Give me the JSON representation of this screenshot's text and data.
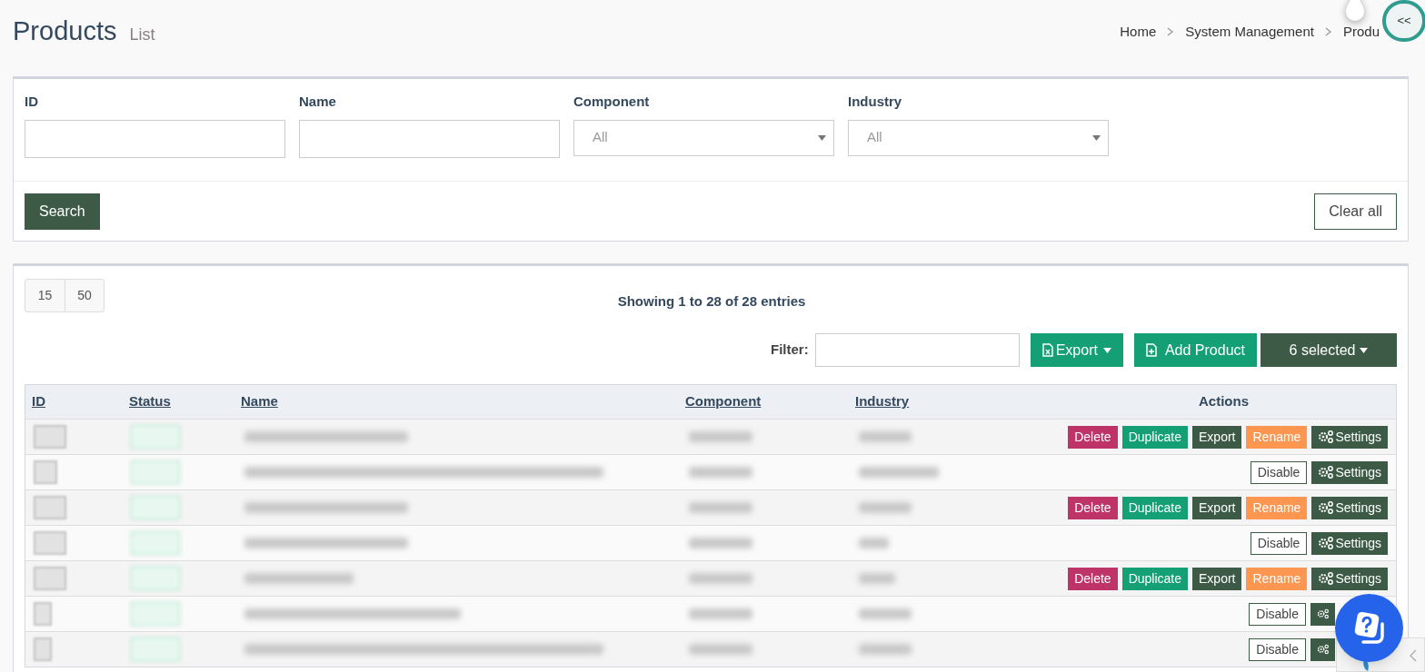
{
  "header": {
    "title": "Products",
    "subtitle": "List",
    "breadcrumb": [
      "Home",
      "System Management",
      "Produ"
    ],
    "collapse_button": "<<"
  },
  "search_form": {
    "fields": [
      {
        "label": "ID",
        "kind": "text"
      },
      {
        "label": "Name",
        "kind": "text"
      },
      {
        "label": "Component",
        "kind": "select",
        "value": "All"
      },
      {
        "label": "Industry",
        "kind": "select",
        "value": "All"
      }
    ],
    "search_button": "Search",
    "clear_button": "Clear all"
  },
  "list": {
    "page_sizes": [
      "15",
      "50"
    ],
    "info": "Showing 1 to 28 of 28 entries",
    "filter_label": "Filter:",
    "export_button": "Export",
    "add_button": "Add Product",
    "selected_button": "6 selected",
    "columns": [
      {
        "label": "ID",
        "sortable": true
      },
      {
        "label": "Status",
        "sortable": true
      },
      {
        "label": "Name",
        "sortable": true
      },
      {
        "label": "Component",
        "sortable": true
      },
      {
        "label": "Industry",
        "sortable": true
      },
      {
        "label": "Actions",
        "sortable": false
      }
    ],
    "rows": [
      {
        "actions": [
          {
            "kind": "delete",
            "label": "Delete"
          },
          {
            "kind": "duplicate",
            "label": "Duplicate"
          },
          {
            "kind": "export",
            "label": "Export"
          },
          {
            "kind": "rename",
            "label": "Rename"
          },
          {
            "kind": "settings",
            "label": "Settings"
          }
        ]
      },
      {
        "actions": [
          {
            "kind": "disable",
            "label": "Disable"
          },
          {
            "kind": "settings",
            "label": "Settings"
          }
        ]
      },
      {
        "actions": [
          {
            "kind": "delete",
            "label": "Delete"
          },
          {
            "kind": "duplicate",
            "label": "Duplicate"
          },
          {
            "kind": "export",
            "label": "Export"
          },
          {
            "kind": "rename",
            "label": "Rename"
          },
          {
            "kind": "settings",
            "label": "Settings"
          }
        ]
      },
      {
        "actions": [
          {
            "kind": "disable",
            "label": "Disable"
          },
          {
            "kind": "settings",
            "label": "Settings"
          }
        ]
      },
      {
        "actions": [
          {
            "kind": "delete",
            "label": "Delete"
          },
          {
            "kind": "duplicate",
            "label": "Duplicate"
          },
          {
            "kind": "export",
            "label": "Export"
          },
          {
            "kind": "rename",
            "label": "Rename"
          },
          {
            "kind": "settings",
            "label": "Settings"
          }
        ]
      },
      {
        "actions": [
          {
            "kind": "disable",
            "label": "Disable"
          },
          {
            "kind": "settings"
          }
        ]
      },
      {
        "actions": [
          {
            "kind": "disable",
            "label": "Disable"
          },
          {
            "kind": "settings"
          }
        ]
      }
    ]
  }
}
